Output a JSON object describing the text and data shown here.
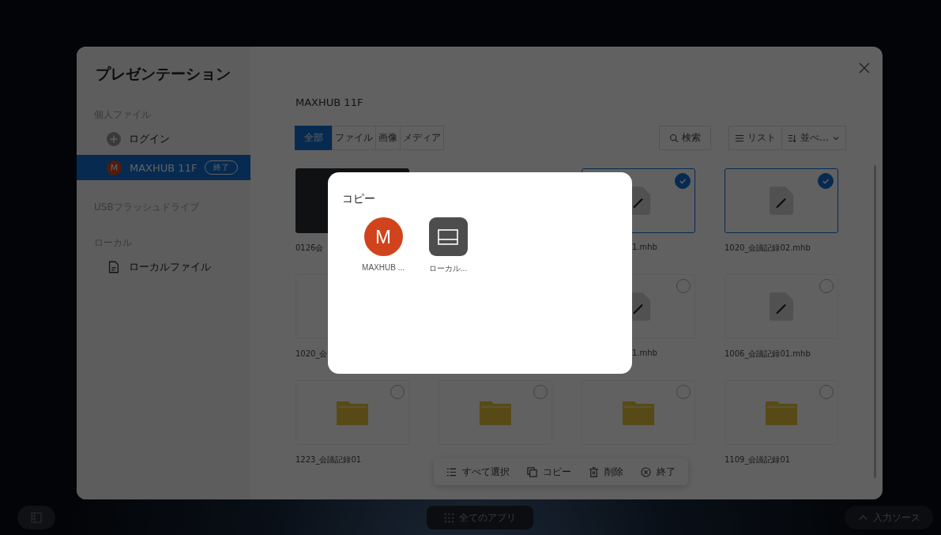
{
  "window": {
    "title": "プレゼンテーション"
  },
  "sidebar": {
    "sections": [
      {
        "heading": "個人ファイル",
        "items": [
          {
            "kind": "add",
            "label": "ログイン",
            "selected": false
          },
          {
            "kind": "account",
            "avatar": "M",
            "label": "MAXHUB 11F",
            "badge": "終了",
            "selected": true
          }
        ]
      },
      {
        "heading": "USBフラッシュドライブ"
      },
      {
        "heading": "ローカル",
        "items": [
          {
            "kind": "local",
            "label": "ローカルファイル",
            "selected": false
          }
        ]
      }
    ]
  },
  "main": {
    "location": "MAXHUB 11F",
    "filter_tabs": [
      {
        "label": "全部",
        "selected": true
      },
      {
        "label": "ファイル",
        "selected": false
      },
      {
        "label": "画像",
        "selected": false
      },
      {
        "label": "メディア",
        "selected": false
      }
    ],
    "search_button": "検索",
    "view_button": "リスト",
    "sort_button": "並べ…"
  },
  "files": [
    {
      "kind": "image",
      "name": "0126会"
    },
    {
      "kind": "covered"
    },
    {
      "kind": "document",
      "name": "1.mhb",
      "checked": true
    },
    {
      "kind": "document",
      "name": "1020_会議記録02.mhb",
      "checked": true
    },
    {
      "kind": "partly_covered",
      "name": "1020_会"
    },
    {
      "kind": "covered"
    },
    {
      "kind": "document",
      "name": "1.mhb",
      "checked": false
    },
    {
      "kind": "document",
      "name": "1006_会議記録01.mhb",
      "checked": false
    },
    {
      "kind": "folder",
      "name": "1223_会議記録01",
      "checked": false
    },
    {
      "kind": "folder",
      "checked": false
    },
    {
      "kind": "folder",
      "checked": false
    },
    {
      "kind": "folder",
      "name": "1109_会議記録01",
      "checked": false
    }
  ],
  "action_bar": [
    {
      "kind": "select_all",
      "label": "すべて選択"
    },
    {
      "kind": "copy",
      "label": "コピー"
    },
    {
      "kind": "delete",
      "label": "削除"
    },
    {
      "kind": "exit",
      "label": "終了"
    }
  ],
  "dialog": {
    "title": "コピー",
    "targets": [
      {
        "kind": "account",
        "avatar": "M",
        "label": "MAXHUB ..."
      },
      {
        "kind": "local",
        "label": "ローカル..."
      }
    ]
  },
  "dock": {
    "apps_button": "全てのアプリ",
    "input_source_button": "入力ソース"
  }
}
